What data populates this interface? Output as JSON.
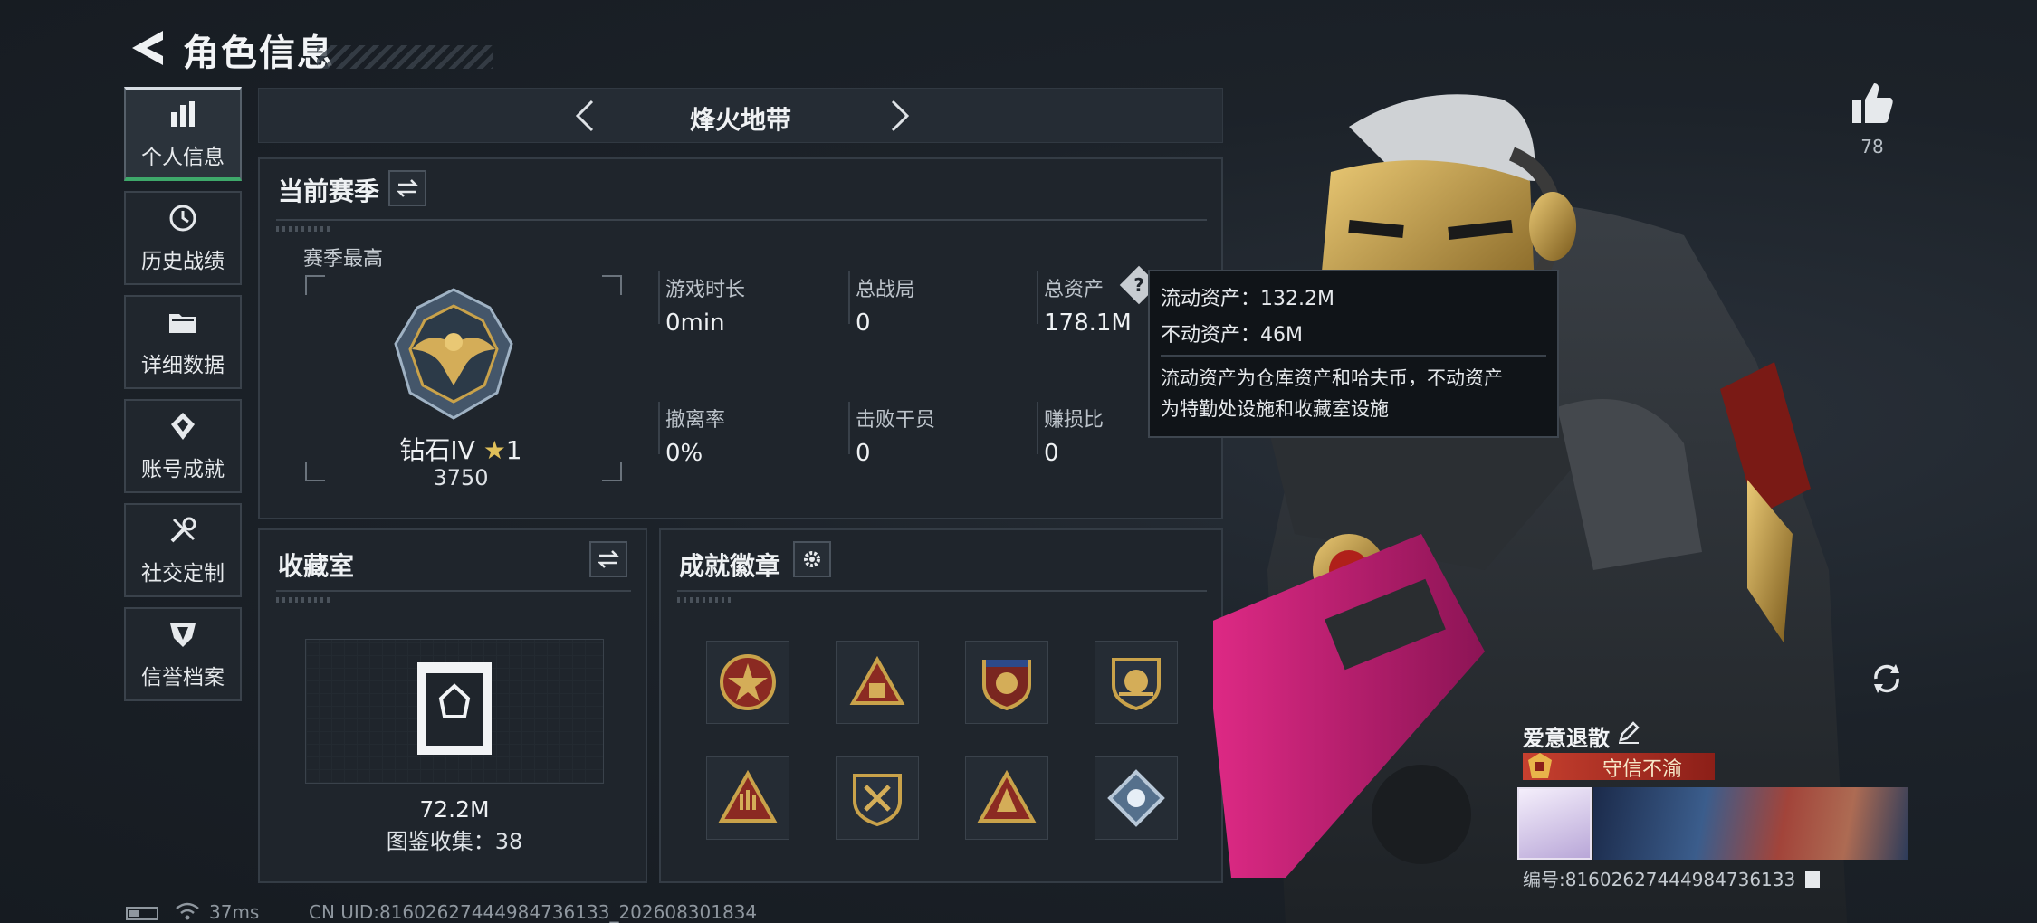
{
  "header": {
    "title": "角色信息"
  },
  "sidebar": {
    "items": [
      {
        "label": "个人信息",
        "icon": "bar-chart-icon",
        "active": true
      },
      {
        "label": "历史战绩",
        "icon": "history-icon",
        "active": false
      },
      {
        "label": "详细数据",
        "icon": "folder-icon",
        "active": false
      },
      {
        "label": "账号成就",
        "icon": "medal-icon",
        "active": false
      },
      {
        "label": "社交定制",
        "icon": "tools-icon",
        "active": false
      },
      {
        "label": "信誉档案",
        "icon": "shield-emblem-icon",
        "active": false
      }
    ]
  },
  "mode": {
    "title": "烽火地带"
  },
  "season": {
    "title": "当前赛季",
    "best_label": "赛季最高",
    "rank": "钻石IV",
    "rank_stars": "1",
    "score": "3750",
    "stats": [
      {
        "label": "游戏时长",
        "value": "0min"
      },
      {
        "label": "总战局",
        "value": "0"
      },
      {
        "label": "总资产",
        "value": "178.1M"
      },
      {
        "label": "撤离率",
        "value": "0%"
      },
      {
        "label": "击败干员",
        "value": "0"
      },
      {
        "label": "赚损比",
        "value": "0"
      }
    ]
  },
  "tooltip": {
    "liquid": "流动资产：132.2M",
    "fixed": "不动资产：46M",
    "desc_line1": "流动资产为仓库资产和哈夫币，不动资产",
    "desc_line2": "为特勤处设施和收藏室设施"
  },
  "collection": {
    "title": "收藏室",
    "value": "72.2M",
    "catalog": "图鉴收集：38"
  },
  "achievements": {
    "title": "成就徽章",
    "badges": [
      "star-badge",
      "pyramid-badge",
      "shield-star-badge",
      "shield-gun-badge",
      "hand-badge",
      "shield-cross-badge",
      "triangle-badge",
      "diamond-badge"
    ]
  },
  "profile": {
    "likes": "78",
    "name": "爱意退散",
    "title": "守信不渝",
    "id": "编号:81602627444984736133"
  },
  "status": {
    "ping": "37ms",
    "uid": "CN UID:81602627444984736133_202608301834"
  },
  "colors": {
    "accent_green": "#3ea86a",
    "gold": "#c9a24a",
    "red_title": "#c7402f"
  }
}
